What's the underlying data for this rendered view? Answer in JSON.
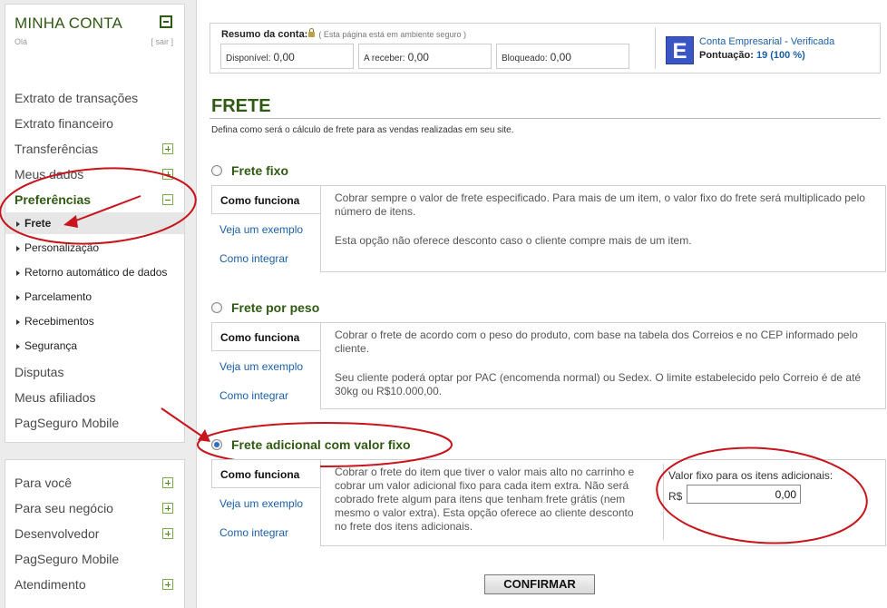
{
  "sidebar": {
    "account_title": "MINHA CONTA",
    "hello": "Olá",
    "logout": "[ sair ]",
    "items": [
      {
        "label": "Extrato de transações"
      },
      {
        "label": "Extrato financeiro"
      },
      {
        "label": "Transferências"
      },
      {
        "label": "Meus dados"
      },
      {
        "label": "Preferências"
      },
      {
        "label": "Disputas"
      },
      {
        "label": "Meus afiliados"
      },
      {
        "label": "PagSeguro Mobile"
      }
    ],
    "sub_items": [
      {
        "label": "Frete"
      },
      {
        "label": "Personalização"
      },
      {
        "label": "Retorno automático de dados"
      },
      {
        "label": "Parcelamento"
      },
      {
        "label": "Recebimentos"
      },
      {
        "label": "Segurança"
      }
    ],
    "bottom_items": [
      {
        "label": "Para você"
      },
      {
        "label": "Para seu negócio"
      },
      {
        "label": "Desenvolvedor"
      },
      {
        "label": "PagSeguro Mobile"
      },
      {
        "label": "Atendimento"
      }
    ]
  },
  "summary": {
    "title": "Resumo da conta:",
    "secure": "( Esta página está em ambiente seguro )",
    "available_label": "Disponível:",
    "available_value": "0,00",
    "receivable_label": "A receber:",
    "receivable_value": "0,00",
    "blocked_label": "Bloqueado:",
    "blocked_value": "0,00",
    "badge": "E",
    "account_type": "Conta Empresarial",
    "dash": "-",
    "verified": "Verificada",
    "score_label": "Pontuação:",
    "score_value": "19 (100 %)"
  },
  "page": {
    "title": "FRETE",
    "description": "Defina como será o cálculo de frete para as vendas realizadas em seu site."
  },
  "tabs": {
    "how": "Como funciona",
    "example": "Veja um exemplo",
    "integrate": "Como integrar"
  },
  "options": [
    {
      "title": "Frete fixo",
      "selected": false,
      "texts": [
        "Cobrar sempre o valor de frete especificado. Para mais de um item, o valor fixo do frete será multiplicado pelo número de itens.",
        "Esta opção não oferece desconto caso o cliente compre mais de um item."
      ]
    },
    {
      "title": "Frete por peso",
      "selected": false,
      "texts": [
        "Cobrar o frete de acordo com o peso do produto, com base na tabela dos Correios e no CEP informado pelo cliente.",
        "Seu cliente poderá optar por PAC (encomenda normal) ou Sedex. O limite estabelecido pelo Correio é de até 30kg ou R$10.000,00."
      ]
    },
    {
      "title": "Frete adicional com valor fixo",
      "selected": true,
      "texts": [
        "Cobrar o frete do item que tiver o valor mais alto no carrinho e cobrar um valor adicional fixo para cada item extra. Não será cobrado frete algum para itens que tenham frete grátis (nem mesmo o valor extra). Esta opção oferece ao cliente desconto no frete dos itens adicionais."
      ]
    }
  ],
  "extra_fee": {
    "label": "Valor fixo para os itens adicionais:",
    "currency": "R$",
    "value": "0,00"
  },
  "confirm_label": "CONFIRMAR",
  "colors": {
    "brand_green": "#2f5a12",
    "link_blue": "#1b5fa8",
    "annotation_red": "#c8141c"
  }
}
